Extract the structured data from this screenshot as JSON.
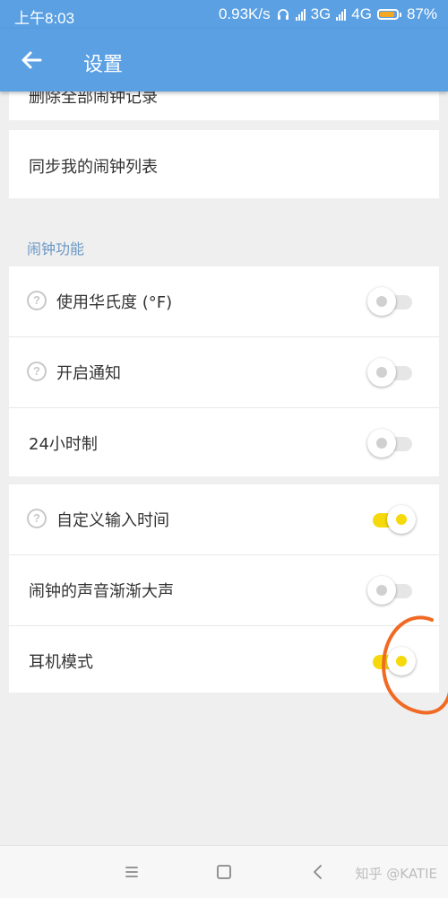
{
  "status_bar": {
    "time": "上午8:03",
    "speed": "0.93K/s",
    "network1": "3G",
    "network2": "4G",
    "battery_percent": "87%",
    "battery_level": 0.87,
    "icons": [
      "headphones-icon",
      "signal-icon",
      "battery-icon"
    ]
  },
  "app_bar": {
    "title": "设置",
    "back_icon": "arrow-left-icon"
  },
  "partial_item": {
    "label": "删除全部闹钟记录"
  },
  "sync_item": {
    "label": "同步我的闹钟列表"
  },
  "section": {
    "title": "闹钟功能"
  },
  "group1": [
    {
      "label": "使用华氏度 (°F)",
      "help": true,
      "toggled": false
    },
    {
      "label": "开启通知",
      "help": true,
      "toggled": false
    },
    {
      "label": "24小时制",
      "help": false,
      "toggled": false
    }
  ],
  "group2": [
    {
      "label": "自定义输入时间",
      "help": true,
      "toggled": true
    },
    {
      "label": "闹钟的声音渐渐大声",
      "help": false,
      "toggled": false
    },
    {
      "label": "耳机模式",
      "help": false,
      "toggled": true
    }
  ],
  "help_glyph": "?",
  "colors": {
    "primary": "#5aa0e3",
    "toggle_on": "#f5d90a",
    "toggle_off": "#e6e6e6",
    "annotation": "#f06a24",
    "section_title": "#6a97c4"
  },
  "nav_bar": {
    "buttons": [
      "menu-icon",
      "home-square-icon",
      "back-chevron-icon"
    ]
  },
  "watermark": "知乎 @KATIE"
}
